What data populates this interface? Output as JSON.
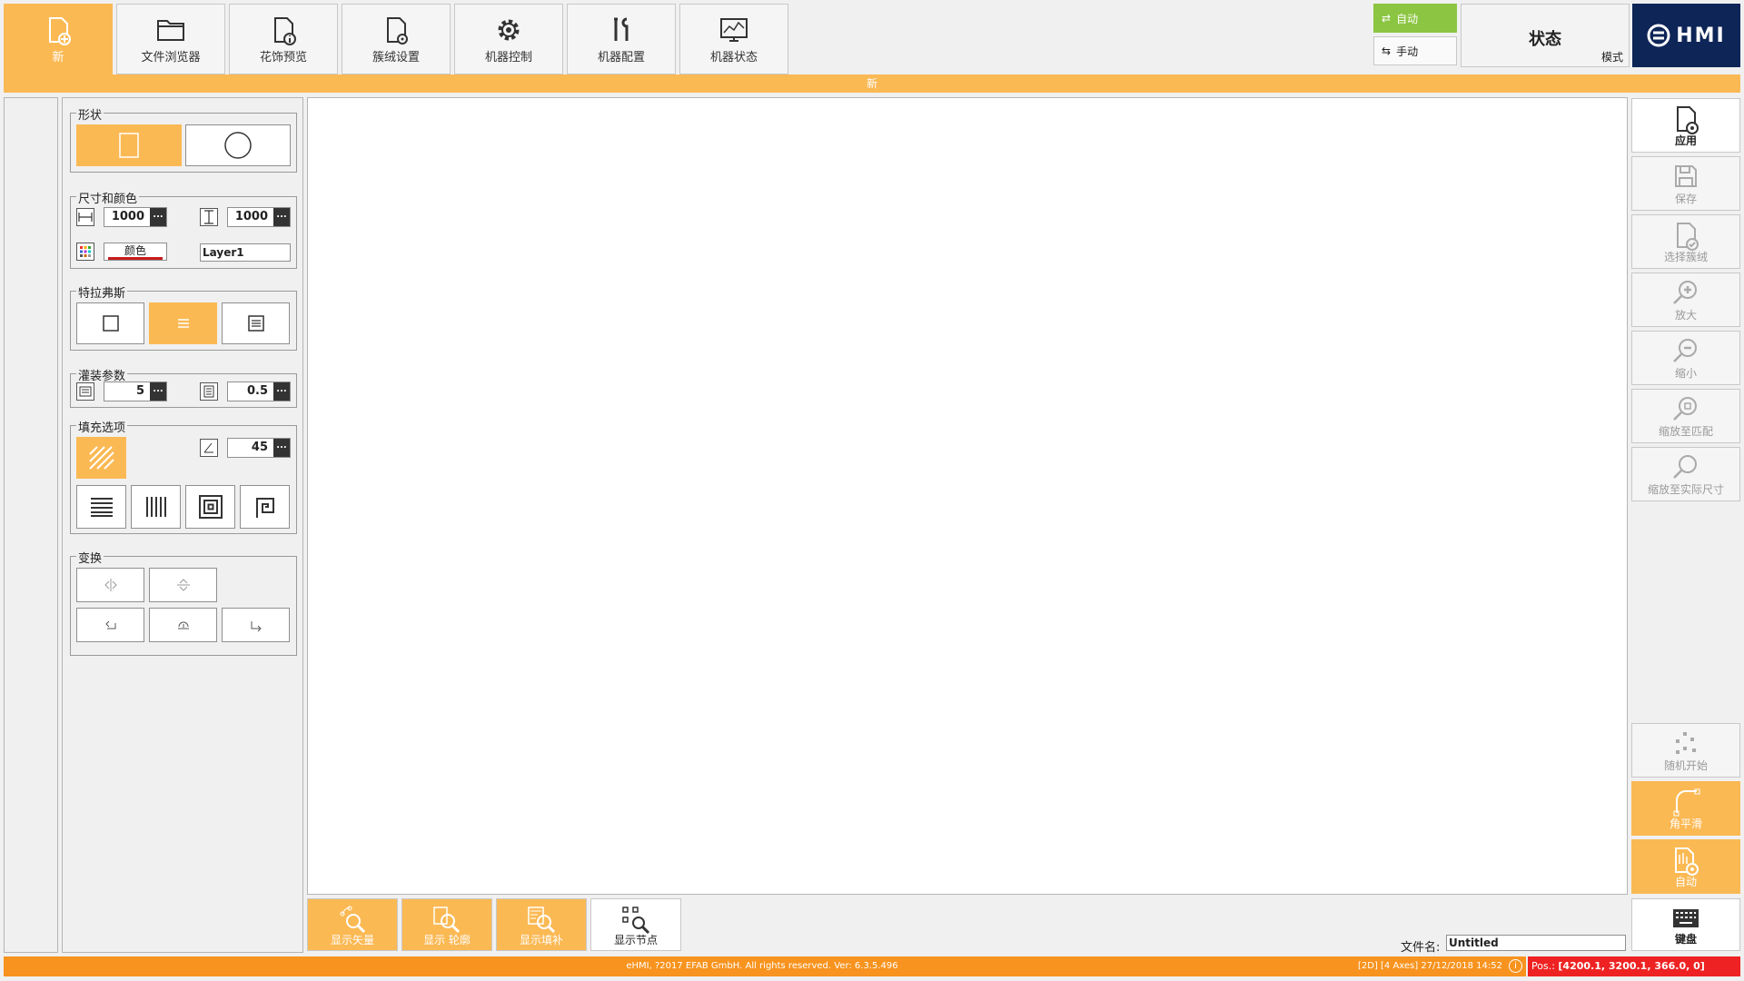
{
  "tabs": [
    {
      "label": "新",
      "icon": "new-file-icon",
      "active": true
    },
    {
      "label": "文件浏览器",
      "icon": "folder-icon",
      "stripe": "#a3233a"
    },
    {
      "label": "花饰预览",
      "icon": "file-info-icon",
      "stripe": "#f5a623"
    },
    {
      "label": "簇绒设置",
      "icon": "file-settings-icon",
      "stripe": "#1d5a9a"
    },
    {
      "label": "机器控制",
      "icon": "gear-icon",
      "stripe": "#8bc541"
    },
    {
      "label": "机器配置",
      "icon": "tools-icon",
      "stripe": "#6fa1d9"
    },
    {
      "label": "机器状态",
      "icon": "monitor-chart-icon",
      "stripe": "#9fc1e8"
    }
  ],
  "mode": {
    "auto_label": "自动",
    "manual_label": "手动"
  },
  "status": {
    "title": "状态",
    "subtitle": "模式"
  },
  "logo": {
    "text": "HMI"
  },
  "header_bar": {
    "text": "新"
  },
  "left": {
    "shape": {
      "title": "形状"
    },
    "size_color": {
      "title": "尺寸和颜色",
      "width": "1000",
      "height": "1000",
      "color_label": "颜色",
      "layer": "Layer1",
      "dots": "..."
    },
    "traverse": {
      "title": "特拉弗斯"
    },
    "fill_params": {
      "title": "灌装参数",
      "value1": "5",
      "value2": "0.5"
    },
    "fill_options": {
      "title": "填充选项",
      "angle": "45"
    },
    "transform": {
      "title": "变换"
    }
  },
  "bottom_tools": [
    {
      "label": "显示矢量",
      "icon": "show-vector-icon"
    },
    {
      "label": "显示 轮廓",
      "icon": "show-outline-icon"
    },
    {
      "label": "显示填补",
      "icon": "show-fill-icon"
    },
    {
      "label": "显示节点",
      "icon": "show-nodes-icon"
    }
  ],
  "filename": {
    "label": "文件名:",
    "value": "Untitled"
  },
  "right_buttons": [
    {
      "label": "应用",
      "icon": "apply-icon"
    },
    {
      "label": "保存",
      "icon": "save-icon"
    },
    {
      "label": "选择簇绒",
      "icon": "select-tuft-icon"
    },
    {
      "label": "放大",
      "icon": "zoom-in-icon"
    },
    {
      "label": "缩小",
      "icon": "zoom-out-icon"
    },
    {
      "label": "缩放至匹配",
      "icon": "zoom-fit-icon"
    },
    {
      "label": "缩放至实际尺寸",
      "icon": "zoom-actual-icon"
    }
  ],
  "right_bottom_buttons": [
    {
      "label": "随机开始",
      "icon": "random-start-icon"
    },
    {
      "label": "角平滑",
      "icon": "corner-smooth-icon"
    },
    {
      "label": "自动",
      "icon": "auto-icon"
    },
    {
      "label": "键盘",
      "icon": "keyboard-icon"
    }
  ],
  "footer": {
    "copyright": "eHMI, ?2017 EFAB GmbH. All rights reserved. Ver: 6.3.5.496",
    "info": "[2D]  [4 Axes]  27/12/2018   14:52",
    "pos_label": "Pos.:",
    "pos_value": "[4200.1, 3200.1, 366.0, 0]"
  },
  "colors": {
    "accent": "#fbb954",
    "auto_green": "#8bc541",
    "brand_navy": "#0e2557",
    "footer_orange": "#f7931e",
    "pos_red": "#ee2222"
  }
}
